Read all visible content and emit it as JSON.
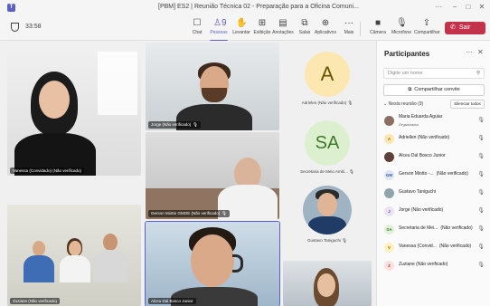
{
  "window": {
    "title": "[PBM] ES2 | Reunião Técnica 02 - Preparação para a Oficina Comuni...",
    "more": "···",
    "minimize": "−",
    "maximize": "□",
    "close": "✕"
  },
  "toolbar": {
    "timer": "33:58",
    "tools": [
      {
        "id": "chat",
        "label": "Chat",
        "icon": "chat-icon",
        "glyph": "☐"
      },
      {
        "id": "pessoas",
        "label": "Pessoas",
        "icon": "people-icon",
        "glyph": "♙",
        "badge": "9"
      },
      {
        "id": "levantar",
        "label": "Levantar",
        "icon": "raise-hand-icon",
        "glyph": "✋"
      },
      {
        "id": "exibicao",
        "label": "Exibição",
        "icon": "grid-icon",
        "glyph": "⊞"
      },
      {
        "id": "anotacoes",
        "label": "Anotações",
        "icon": "notes-icon",
        "glyph": "▤"
      },
      {
        "id": "salas",
        "label": "Salas",
        "icon": "rooms-icon",
        "glyph": "⧉"
      },
      {
        "id": "aplicativos",
        "label": "Aplicativos",
        "icon": "apps-icon",
        "glyph": "⊕"
      },
      {
        "id": "mais",
        "label": "Mais",
        "icon": "more-icon",
        "glyph": "···"
      },
      {
        "id": "camera",
        "label": "Câmera",
        "icon": "camera-icon",
        "glyph": "■"
      },
      {
        "id": "microfone",
        "label": "Microfone",
        "icon": "mic-off-icon",
        "glyph": "🎙"
      },
      {
        "id": "compartilhar",
        "label": "Compartilhar",
        "icon": "share-icon",
        "glyph": "⇪"
      }
    ],
    "leave_label": "Sair"
  },
  "tiles": {
    "vanessa": "Vanessa (Convidado) (Não verificado)",
    "jorge": "Jorge (Não verificado)",
    "gerson": "Gerson Miotto GMOE (Não verificado)",
    "zuziane": "Zuziane (Não verificado)",
    "alceu": "Alceu Dal Bosco Junior",
    "adriellen": "Adrielen (Não verificado)",
    "adrielen_initial": "A",
    "secretaria": "Secretaria de Meio Ambi...",
    "secretaria_initials": "SA",
    "gustavo": "Gustavo Taniguchi"
  },
  "panel": {
    "title": "Participantes",
    "more": "···",
    "close": "✕",
    "search_placeholder": "Digite um nome",
    "share_invite": "Compartilhar convite",
    "section": "Nesta reunião (9)",
    "mute_all": "Silenciar todos",
    "participants": [
      {
        "name": "Maria Eduarda Aguiar",
        "role": "Organizador",
        "initials": "",
        "color": "#8d6e63",
        "fg": "#ffffff",
        "photo": true
      },
      {
        "name": "Adriellen (Não verificado)",
        "role": "",
        "initials": "A",
        "color": "#fde7b0",
        "fg": "#8a6a00"
      },
      {
        "name": "Alceu Dal Bosco Junior",
        "role": "",
        "initials": "",
        "color": "#5d4037",
        "fg": "#ffffff",
        "photo": true
      },
      {
        "name": "Gerson Miotto -...",
        "role": "(Não verificado)",
        "initials": "GM",
        "color": "#dfe6f5",
        "fg": "#3b5b99",
        "inline_role": true
      },
      {
        "name": "Gustavo Taniguchi",
        "role": "",
        "initials": "",
        "color": "#90a4ae",
        "fg": "#ffffff",
        "photo": true
      },
      {
        "name": "Jorge (Não verificado)",
        "role": "",
        "initials": "J",
        "color": "#ece2f5",
        "fg": "#6b3f99"
      },
      {
        "name": "Secretaria de Mei...",
        "role": "(Não verificado)",
        "initials": "SA",
        "color": "#e1f0d9",
        "fg": "#3f7a2b",
        "inline_role": true
      },
      {
        "name": "Vanessa (Convid...",
        "role": "(Não verificado)",
        "initials": "V",
        "color": "#fff1c2",
        "fg": "#8a6a00",
        "inline_role": true
      },
      {
        "name": "Zuziane (Não verificado)",
        "role": "",
        "initials": "Z",
        "color": "#fbe0e0",
        "fg": "#a33b3b"
      }
    ]
  }
}
